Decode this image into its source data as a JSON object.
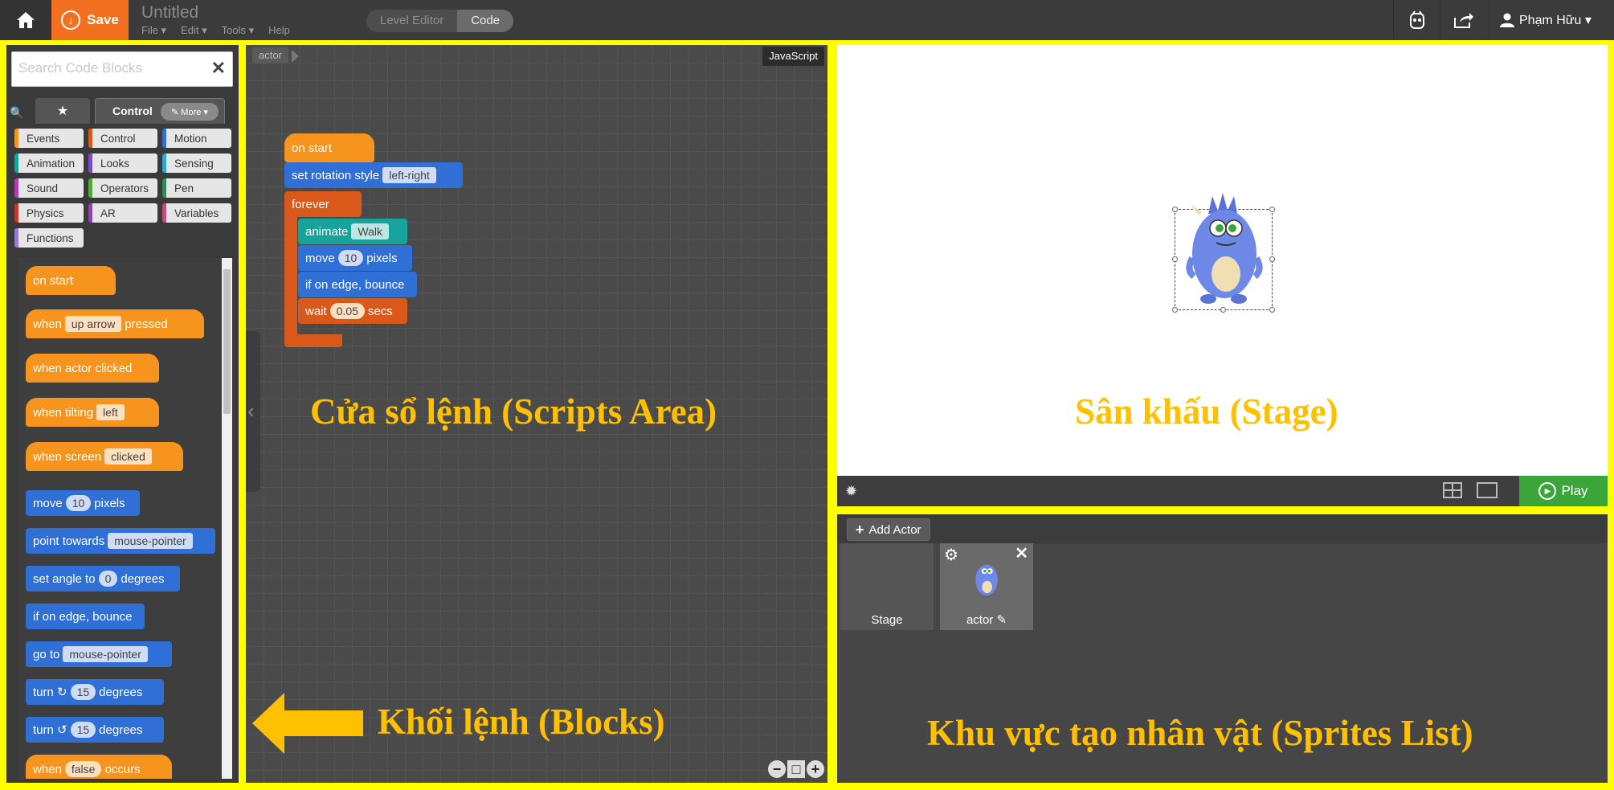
{
  "topbar": {
    "save_label": "Save",
    "doc_title": "Untitled",
    "menu": [
      "File ▾",
      "Edit ▾",
      "Tools ▾",
      "Help"
    ],
    "modes": [
      "Level Editor",
      "Code"
    ],
    "active_mode": "Code",
    "user_name": "Phạm Hữu ▾"
  },
  "blocks_panel": {
    "search_placeholder": "Search Code Blocks",
    "tab_control_label": "Control",
    "more_label": "✎ More ▾",
    "categories": [
      {
        "label": "Events",
        "color": "#f7941d"
      },
      {
        "label": "Control",
        "color": "#d9581a"
      },
      {
        "label": "Motion",
        "color": "#2f6fd6"
      },
      {
        "label": "Animation",
        "color": "#15a39b"
      },
      {
        "label": "Looks",
        "color": "#7b4dc4"
      },
      {
        "label": "Sensing",
        "color": "#2aa8d8"
      },
      {
        "label": "Sound",
        "color": "#b23ab5"
      },
      {
        "label": "Operators",
        "color": "#56a83a"
      },
      {
        "label": "Pen",
        "color": "#2e8b57"
      },
      {
        "label": "Physics",
        "color": "#c0392b"
      },
      {
        "label": "AR",
        "color": "#8e44ad"
      },
      {
        "label": "Variables",
        "color": "#c44d7a"
      },
      {
        "label": "Functions",
        "color": "#9b7bd0"
      }
    ],
    "palette": [
      {
        "text": "on start"
      },
      {
        "pre": "when",
        "arg": "up arrow",
        "post": "pressed"
      },
      {
        "text": "when actor clicked"
      },
      {
        "pre": "when tilting",
        "arg": "left",
        "post": ""
      },
      {
        "pre": "when screen",
        "arg": "clicked",
        "post": ""
      },
      {
        "pre": "move",
        "arg": "10",
        "post": "pixels"
      },
      {
        "pre": "point towards",
        "arg": "mouse-pointer",
        "post": ""
      },
      {
        "pre": "set angle to",
        "arg": "0",
        "post": "degrees"
      },
      {
        "text": "if on edge, bounce"
      },
      {
        "pre": "go to",
        "arg": "mouse-pointer",
        "post": ""
      },
      {
        "pre": "turn ↻",
        "arg": "15",
        "post": "degrees"
      },
      {
        "pre": "turn ↺",
        "arg": "15",
        "post": "degrees"
      },
      {
        "pre": "when",
        "arg": "false",
        "post": "occurs"
      }
    ]
  },
  "scripts_area": {
    "crumb": "actor",
    "lang_button": "JavaScript",
    "stack": {
      "on_start": "on start",
      "set_rotation": "set rotation style",
      "set_rotation_arg": "left-right",
      "forever": "forever",
      "animate": "animate",
      "animate_arg": "Walk",
      "move": "move",
      "move_arg": "10",
      "move_post": "pixels",
      "bounce": "if on edge, bounce",
      "wait": "wait",
      "wait_arg": "0.05",
      "wait_post": "secs"
    },
    "caption": "Cửa sổ lệnh (Scripts Area)"
  },
  "blocks_caption": "Khối lệnh (Blocks)",
  "stage": {
    "caption": "Sân khấu (Stage)",
    "play_label": "Play"
  },
  "sprites": {
    "add_actor_label": "Add Actor",
    "cards": [
      {
        "name": "Stage"
      },
      {
        "name": "actor ✎"
      }
    ],
    "caption": "Khu vực tạo nhân vật (Sprites List)"
  },
  "colors": {
    "frame": "#ffff00",
    "caption": "#ffc000",
    "save": "#f37021",
    "play": "#3aa63a"
  }
}
